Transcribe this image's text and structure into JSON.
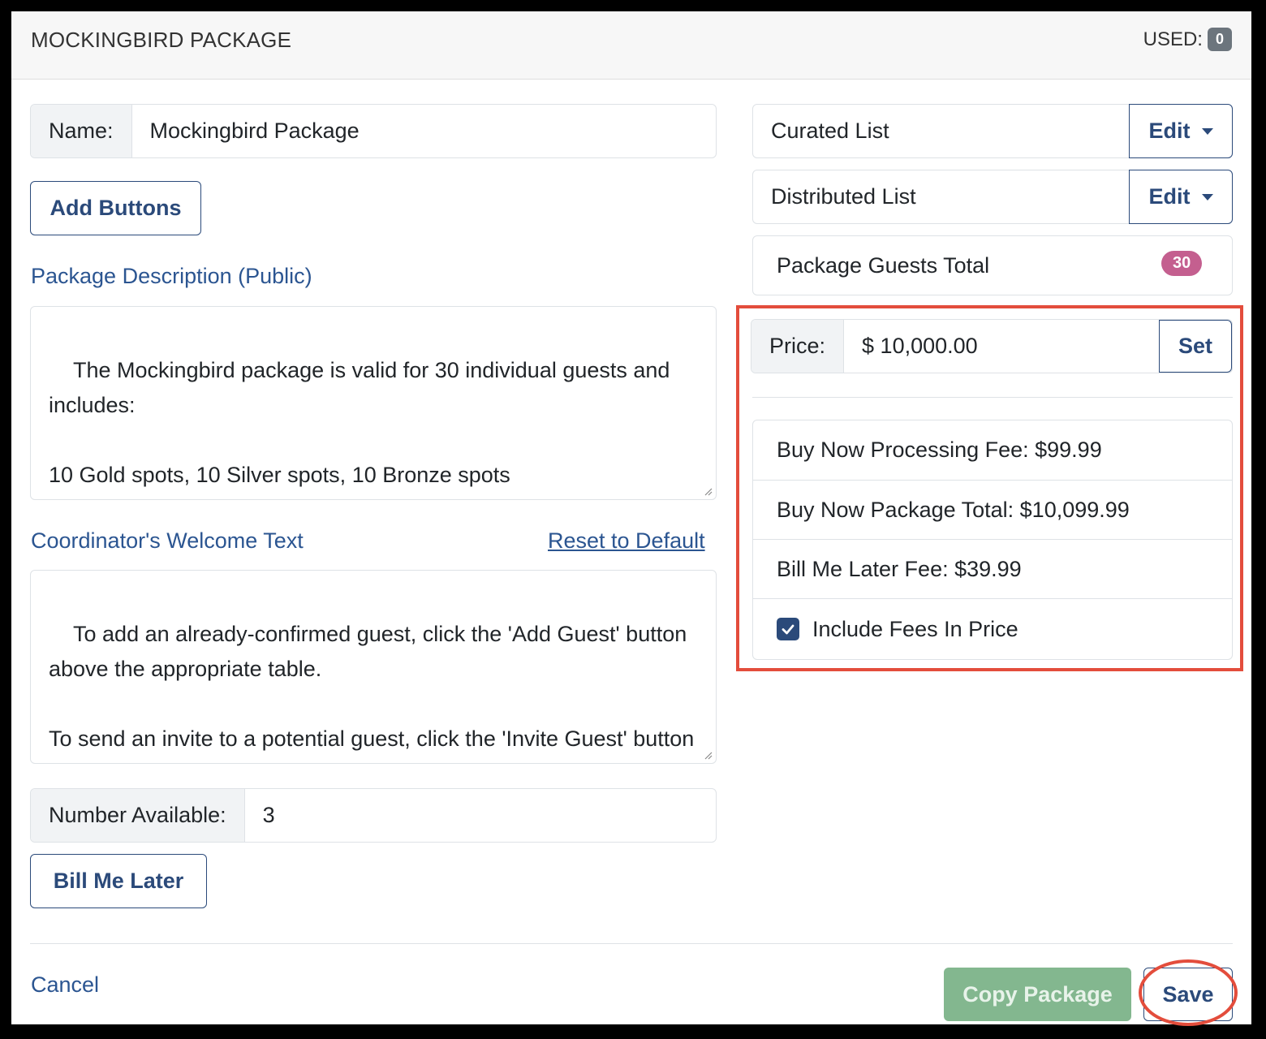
{
  "header": {
    "title": "MOCKINGBIRD PACKAGE",
    "used_label": "USED:",
    "used_count": "0"
  },
  "name_field": {
    "label": "Name:",
    "value": "Mockingbird Package"
  },
  "add_buttons_label": "Add Buttons",
  "description": {
    "label": "Package Description (Public)",
    "value": "The Mockingbird package is valid for 30 individual guests and includes:\n\n10 Gold spots, 10 Silver spots, 10 Bronze spots"
  },
  "welcome": {
    "label": "Coordinator's Welcome Text",
    "reset_link": "Reset to Default",
    "value": "To add an already-confirmed guest, click the 'Add Guest' button above the appropriate table.\n\nTo send an invite to a potential guest, click the 'Invite Guest' button above the appropriate table. The guest will receive an"
  },
  "number_available": {
    "label": "Number Available:",
    "value": "3"
  },
  "bill_me_later_label": "Bill Me Later",
  "lists": {
    "curated": {
      "label": "Curated List",
      "edit": "Edit"
    },
    "distributed": {
      "label": "Distributed List",
      "edit": "Edit"
    }
  },
  "guests_total": {
    "label": "Package Guests Total",
    "count": "30"
  },
  "price": {
    "label": "Price:",
    "value": "$ 10,000.00",
    "set_label": "Set"
  },
  "fees": {
    "processing": "Buy Now Processing Fee: $99.99",
    "package_total": "Buy Now Package Total: $10,099.99",
    "bill_later_fee": "Bill Me Later Fee: $39.99",
    "include_fees_label": "Include Fees In Price",
    "include_fees_checked": true
  },
  "footer": {
    "cancel": "Cancel",
    "copy": "Copy Package",
    "save": "Save"
  },
  "colors": {
    "primary": "#2b4a7a",
    "link": "#2b5591",
    "highlight": "#e34d3c",
    "badge_pink": "#c45f8f",
    "copy_green": "#83b78f"
  }
}
